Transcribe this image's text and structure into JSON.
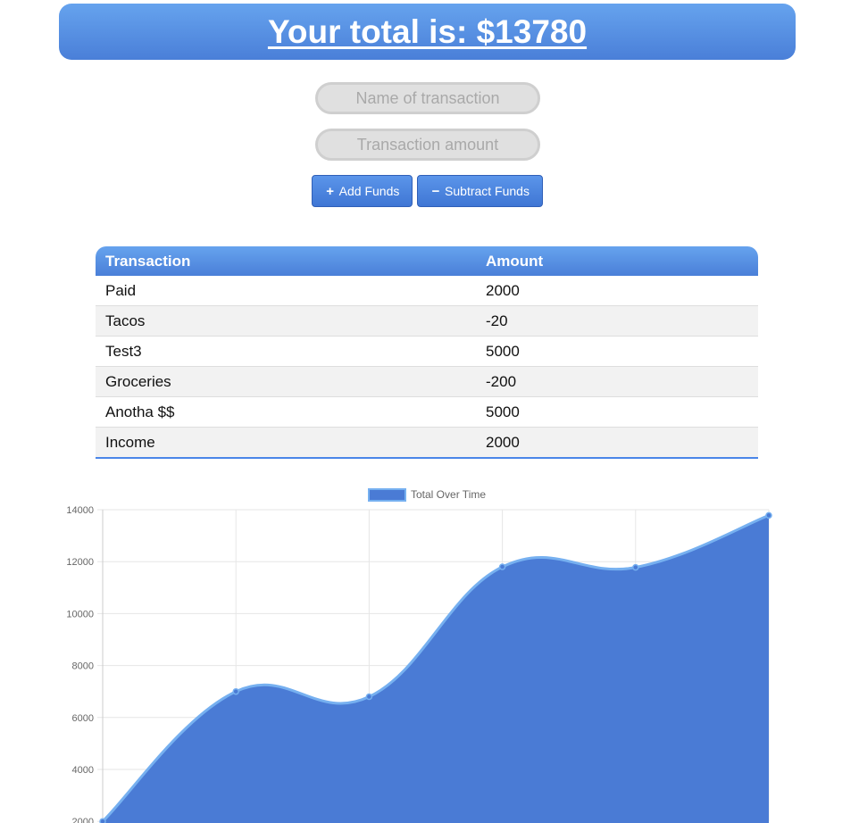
{
  "header": {
    "total_text": "Your total is: $13780"
  },
  "form": {
    "name_placeholder": "Name of transaction",
    "amount_placeholder": "Transaction amount",
    "add_label": "Add Funds",
    "subtract_label": "Subtract Funds",
    "add_icon": "plus-icon",
    "subtract_icon": "minus-icon"
  },
  "table": {
    "headers": [
      "Transaction",
      "Amount"
    ],
    "rows": [
      {
        "name": "Paid",
        "amount": "2000"
      },
      {
        "name": "Tacos",
        "amount": "-20"
      },
      {
        "name": "Test3",
        "amount": "5000"
      },
      {
        "name": "Groceries",
        "amount": "-200"
      },
      {
        "name": "Anotha $$",
        "amount": "5000"
      },
      {
        "name": "Income",
        "amount": "2000"
      }
    ]
  },
  "colors": {
    "accent": "#4a7fd8",
    "area_fill": "#4a7bd5",
    "line": "#76b0f0"
  },
  "chart_data": {
    "type": "area",
    "legend": "Total Over Time",
    "legend_position": "top",
    "series": [
      {
        "name": "Total Over Time",
        "values": [
          2000,
          7000,
          6800,
          11800,
          11780,
          13780
        ]
      }
    ],
    "yticks": [
      2000,
      4000,
      6000,
      8000,
      10000,
      12000,
      14000
    ],
    "ylim": [
      2000,
      14000
    ],
    "grid": true
  }
}
